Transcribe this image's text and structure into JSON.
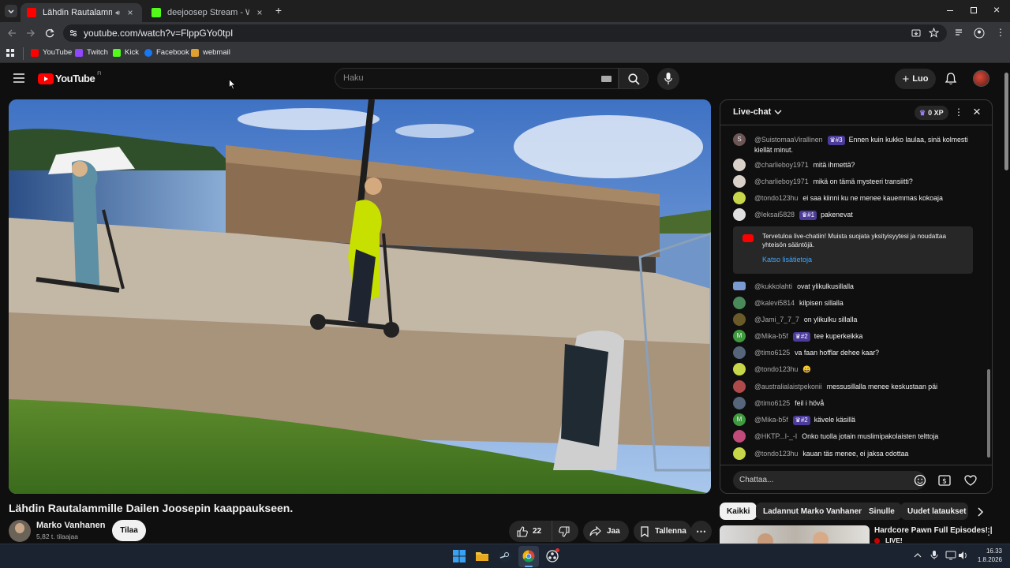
{
  "browser": {
    "tabs": [
      {
        "title": "Lähdin Rautalammille Daile",
        "active": true
      },
      {
        "title": "deejoosep Stream - Watch Live",
        "active": false
      }
    ],
    "new_tab": "+",
    "url": "youtube.com/watch?v=FlppGYo0tpI",
    "bookmarks": [
      "YouTube",
      "Twitch",
      "Kick",
      "Facebook",
      "webmail"
    ]
  },
  "youtube": {
    "logo": "YouTube",
    "region": "FI",
    "search_placeholder": "Haku",
    "create_label": "Luo"
  },
  "video": {
    "title": "Lähdin Rautalammille Dailen Joosepin kaappaukseen.",
    "channel": "Marko Vanhanen",
    "subscribers": "5,82 t. tilaajaa",
    "subscribe_label": "Tilaa",
    "likes": "22",
    "share_label": "Jaa",
    "save_label": "Tallenna"
  },
  "chat": {
    "title": "Live-chat",
    "xp": "0 XP",
    "messages": [
      {
        "author": "@SuistomaaVirallinen",
        "badge": "#3",
        "text": "Ennen kuin kukko laulaa, sinä kolmesti kiellät minut.",
        "avatar_letter": "S",
        "avatar_color": "#6b5555"
      },
      {
        "author": "@charlieboy1971",
        "badge": "",
        "text": "mitä ihmettä?",
        "avatar_letter": "",
        "avatar_color": "#d9d0c8"
      },
      {
        "author": "@charlieboy1971",
        "badge": "",
        "text": "mikä on tämä mysteeri transiitti?",
        "avatar_letter": "",
        "avatar_color": "#d9d0c8"
      },
      {
        "author": "@tondo123hu",
        "badge": "",
        "text": "ei saa kiinni ku ne menee kauemmas kokoaja",
        "avatar_letter": "",
        "avatar_color": "#c8d64a"
      },
      {
        "author": "@leksai5828",
        "badge": "#1",
        "text": "pakenevat",
        "avatar_letter": "",
        "avatar_color": "#e0e0e0"
      },
      {
        "author": "@kukkolahti",
        "badge": "",
        "text": "ovat ylikulkusillalla",
        "avatar_letter": "",
        "avatar_color": "#7a9bd1"
      },
      {
        "author": "@kalevi5814",
        "badge": "",
        "text": "kilpisen sillalla",
        "avatar_letter": "",
        "avatar_color": "#4a8a5a"
      },
      {
        "author": "@Jami_7_7_7",
        "badge": "",
        "text": "on ylikulku sillalla",
        "avatar_letter": "",
        "avatar_color": "#6a5a2a"
      },
      {
        "author": "@Mika-b5f",
        "badge": "#2",
        "text": "tee kuperkeikka",
        "avatar_letter": "M",
        "avatar_color": "#3f9a3f"
      },
      {
        "author": "@timo6125",
        "badge": "",
        "text": "va faan hofflar dehee kaar?",
        "avatar_letter": "",
        "avatar_color": "#55657a"
      },
      {
        "author": "@tondo123hu",
        "badge": "",
        "text": "😀",
        "avatar_letter": "",
        "avatar_color": "#c8d64a"
      },
      {
        "author": "@australialaistpekonii",
        "badge": "",
        "text": "messusillalla menee keskustaan päi",
        "avatar_letter": "",
        "avatar_color": "#b04a4a"
      },
      {
        "author": "@timo6125",
        "badge": "",
        "text": "feil i hövå",
        "avatar_letter": "",
        "avatar_color": "#55657a"
      },
      {
        "author": "@Mika-b5f",
        "badge": "#2",
        "text": "kävele käsillä",
        "avatar_letter": "M",
        "avatar_color": "#3f9a3f"
      },
      {
        "author": "@HKTP...I-_-I",
        "badge": "",
        "text": "Onko tuolla jotain muslimipakolaisten telttoja",
        "avatar_letter": "",
        "avatar_color": "#c04a7a"
      },
      {
        "author": "@tondo123hu",
        "badge": "",
        "text": "kauan täs menee, ei jaksa odottaa",
        "avatar_letter": "",
        "avatar_color": "#c8d64a"
      }
    ],
    "notice_text": "Tervetuloa live-chatiin! Muista suojata yksityisyytesi ja noudattaa yhteisön sääntöjä.",
    "notice_link": "Katso lisätietoja",
    "input_placeholder": "Chattaa..."
  },
  "chips": [
    "Kaikki",
    "Ladannut Marko Vanhanen",
    "Sinulle",
    "Uudet lataukset"
  ],
  "recommendation": {
    "title": "Hardcore Pawn Full Episodes! |",
    "live": "LIVE!"
  },
  "taskbar": {
    "time": "16.33",
    "date": "1.8.2026"
  },
  "colors": {
    "youtube_red": "#ff0000",
    "badge_purple": "#4c3b9a",
    "chat_link": "#3ea6ff"
  }
}
